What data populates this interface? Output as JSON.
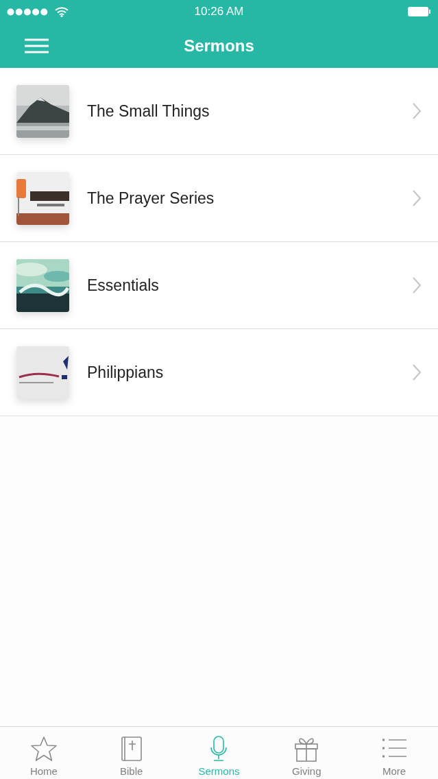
{
  "status_bar": {
    "time": "10:26 AM"
  },
  "nav_bar": {
    "title": "Sermons"
  },
  "sermons": [
    {
      "title": "The Small Things"
    },
    {
      "title": "The Prayer Series"
    },
    {
      "title": "Essentials"
    },
    {
      "title": "Philippians"
    }
  ],
  "tab_bar": [
    {
      "label": "Home",
      "selected": false
    },
    {
      "label": "Bible",
      "selected": false
    },
    {
      "label": "Sermons",
      "selected": true
    },
    {
      "label": "Giving",
      "selected": false
    },
    {
      "label": "More",
      "selected": false
    }
  ]
}
